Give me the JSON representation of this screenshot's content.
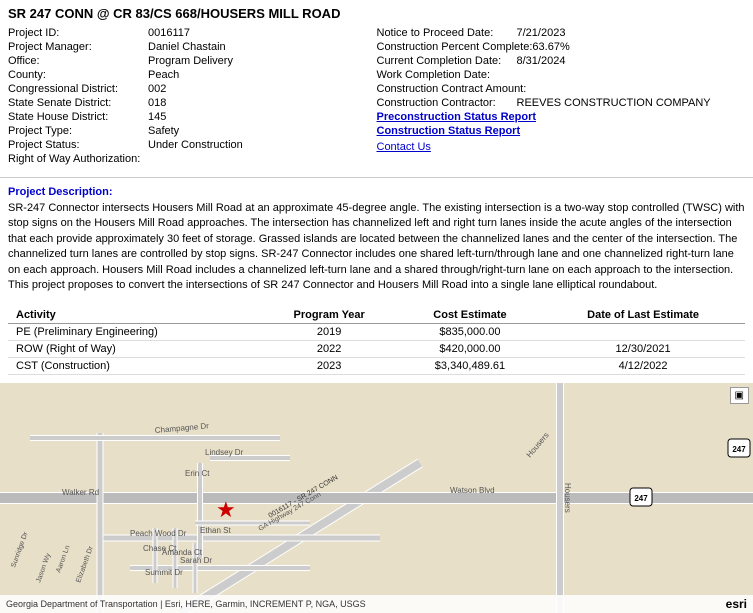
{
  "header": {
    "title": "SR 247 CONN @ CR 83/CS 668/HOUSERS MILL ROAD"
  },
  "project_info": {
    "left": [
      {
        "label": "Project ID:",
        "value": "0016117",
        "type": "normal"
      },
      {
        "label": "Project Manager:",
        "value": "Daniel Chastain",
        "type": "normal"
      },
      {
        "label": "Office:",
        "value": "Program Delivery",
        "type": "normal"
      },
      {
        "label": "County:",
        "value": "Peach",
        "type": "normal"
      },
      {
        "label": "Congressional District:",
        "value": "002",
        "type": "normal"
      },
      {
        "label": "State Senate District:",
        "value": "018",
        "type": "normal"
      },
      {
        "label": "State House District:",
        "value": "145",
        "type": "normal"
      },
      {
        "label": "Project Type:",
        "value": "Safety",
        "type": "normal"
      },
      {
        "label": "Project Status:",
        "value": "Under Construction",
        "type": "normal"
      },
      {
        "label": "Right of Way Authorization:",
        "value": "",
        "type": "normal"
      }
    ],
    "right": [
      {
        "label": "Notice to Proceed Date:",
        "value": "7/21/2023",
        "type": "normal"
      },
      {
        "label": "Construction Percent Complete:",
        "value": "63.67%",
        "type": "normal"
      },
      {
        "label": "Current Completion Date:",
        "value": "8/31/2024",
        "type": "normal"
      },
      {
        "label": "Work Completion Date:",
        "value": "",
        "type": "normal"
      },
      {
        "label": "Construction Contract Amount:",
        "value": "",
        "type": "normal"
      },
      {
        "label": "Construction Contractor:",
        "value": "REEVES CONSTRUCTION COMPANY",
        "type": "normal"
      },
      {
        "label": "Preconstruction Status Report",
        "value": "",
        "type": "bold-link"
      },
      {
        "label": "Construction Status Report",
        "value": "",
        "type": "bold-link"
      },
      {
        "label": "",
        "value": "",
        "type": "normal"
      },
      {
        "label": "Contact Us",
        "value": "",
        "type": "link"
      }
    ]
  },
  "description": {
    "label": "Project Description:",
    "text": "SR-247 Connector intersects Housers Mill Road at an approximate 45-degree angle. The existing intersection is a two-way stop controlled (TWSC) with stop signs on the Housers Mill Road approaches. The intersection has channelized left and right turn lanes inside the acute angles of the intersection that each provide approximately 30 feet of storage. Grassed islands are located between the channelized lanes and the center of the intersection. The channelized turn lanes are controlled by stop signs. SR-247 Connector includes one shared left-turn/through lane and one channelized right-turn lane on each approach. Housers Mill Road includes a channelized left-turn lane and a shared through/right-turn lane on each approach to the intersection. This project proposes to convert the intersections of SR 247 Connector and Housers Mill Road into a single lane elliptical roundabout."
  },
  "activities": {
    "headers": [
      "Activity",
      "Program Year",
      "Cost Estimate",
      "Date of Last Estimate"
    ],
    "rows": [
      {
        "activity": "PE (Preliminary Engineering)",
        "year": "2019",
        "cost": "$835,000.00",
        "date": ""
      },
      {
        "activity": "ROW (Right of Way)",
        "year": "2022",
        "cost": "$420,000.00",
        "date": "12/30/2021"
      },
      {
        "activity": "CST (Construction)",
        "year": "2023",
        "cost": "$3,340,489.61",
        "date": "4/12/2022"
      }
    ]
  },
  "map": {
    "footer_text": "Georgia Department of Transportation | Esri, HERE, Garmin, INCREMENT P, NGA, USGS",
    "esri_text": "esri",
    "expand_icon": "⊞",
    "star_top": "55%",
    "star_left": "30%"
  }
}
